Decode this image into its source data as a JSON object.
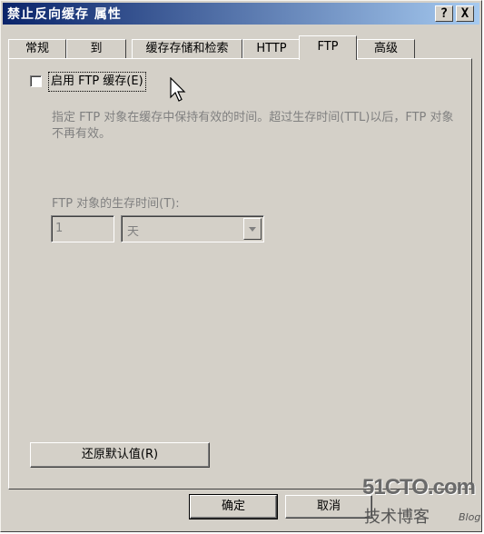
{
  "window": {
    "title": "禁止反向缓存 属性",
    "help_button": "?",
    "close_button": "X"
  },
  "tabs": [
    {
      "label": "常规",
      "active": false
    },
    {
      "label": "到",
      "active": false
    },
    {
      "label": "缓存存储和检索",
      "active": false
    },
    {
      "label": "HTTP",
      "active": false
    },
    {
      "label": "FTP",
      "active": true
    },
    {
      "label": "高级",
      "active": false
    }
  ],
  "ftp": {
    "enable_cache_label": "启用 FTP 缓存(E)",
    "enable_cache_checked": false,
    "description": "指定 FTP 对象在缓存中保持有效的时间。超过生存时间(TTL)以后，FTP 对象不再有效。",
    "ttl_label": "FTP 对象的生存时间(T):",
    "ttl_value": "1",
    "ttl_unit": "天",
    "restore_defaults_label": "还原默认值(R)"
  },
  "footer": {
    "ok_label": "确定",
    "cancel_label": "取消"
  },
  "watermark": {
    "site": "51CTO.com",
    "text": "技术博客",
    "blog": "Blog"
  },
  "colors": {
    "dialog_bg": "#d4d0c8",
    "title_start": "#0a246a",
    "title_end": "#a6caf0",
    "disabled_text": "#808080"
  }
}
